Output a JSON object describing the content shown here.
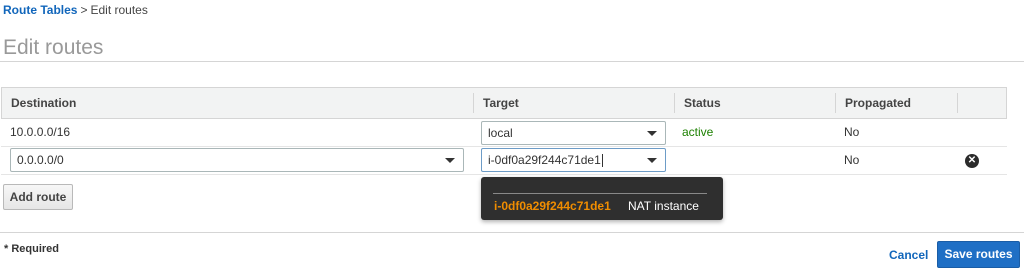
{
  "breadcrumb": {
    "parent": "Route Tables",
    "separator": ">",
    "current": "Edit routes"
  },
  "page_title": "Edit routes",
  "table": {
    "columns": [
      "Destination",
      "Target",
      "Status",
      "Propagated"
    ],
    "rows": [
      {
        "destination": "10.0.0.0/16",
        "target": "local",
        "status": "active",
        "propagated": "No"
      },
      {
        "destination": "0.0.0.0/0",
        "target": "i-0df0a29f244c71de1",
        "status": "",
        "propagated": "No"
      }
    ]
  },
  "dropdown": {
    "option_id": "i-0df0a29f244c71de1",
    "option_desc": "NAT instance"
  },
  "buttons": {
    "add_route": "Add route",
    "cancel": "Cancel",
    "save": "Save routes"
  },
  "required_note": "* Required",
  "icons": {
    "caret": "chevron-down-icon",
    "remove": "close-circle-icon"
  },
  "colors": {
    "link": "#1166bb",
    "primary": "#1f6fc5",
    "active": "#1d8102",
    "highlight": "#f08d00"
  }
}
